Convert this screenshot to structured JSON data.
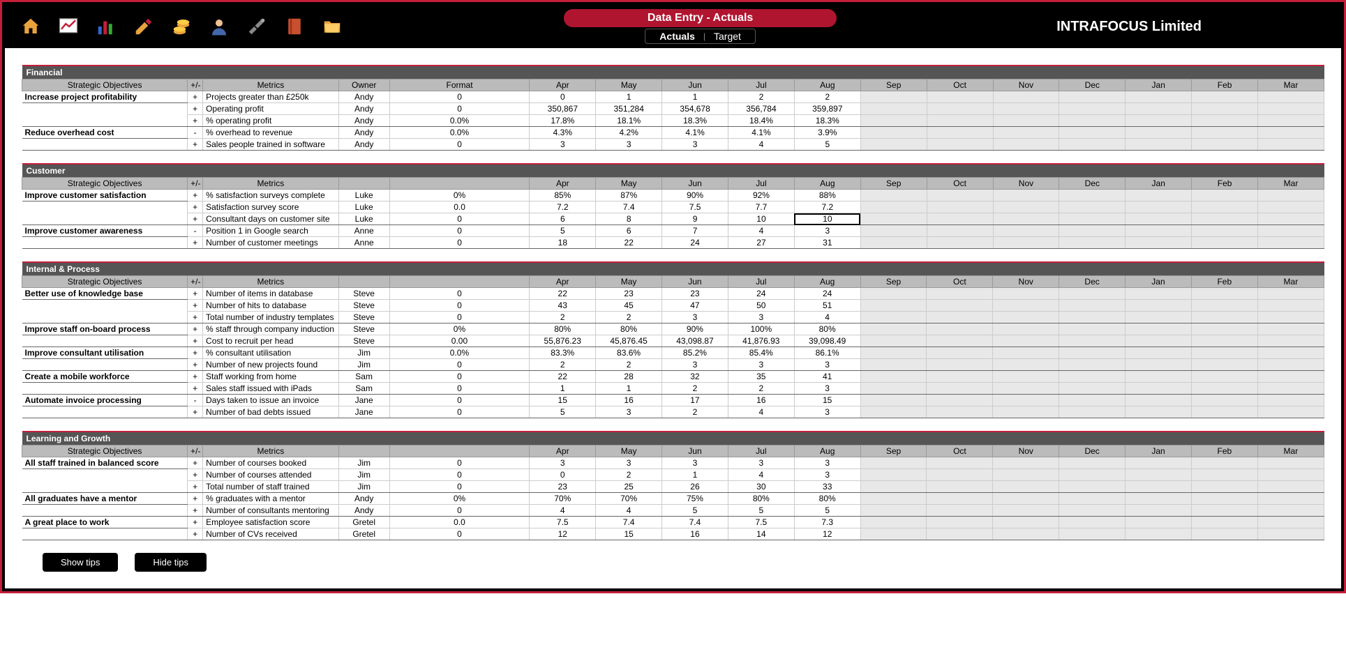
{
  "header": {
    "title": "Data Entry - Actuals",
    "tabs": {
      "actuals": "Actuals",
      "target": "Target"
    },
    "company": "INTRAFOCUS Limited"
  },
  "columns": {
    "strategic": "Strategic Objectives",
    "sign": "+/-",
    "metrics": "Metrics",
    "owner": "Owner",
    "format": "Format",
    "months": [
      "Apr",
      "May",
      "Jun",
      "Jul",
      "Aug",
      "Sep",
      "Oct",
      "Nov",
      "Dec",
      "Jan",
      "Feb",
      "Mar"
    ]
  },
  "buttons": {
    "show": "Show tips",
    "hide": "Hide tips"
  },
  "sections": [
    {
      "name": "Financial",
      "showOwner": true,
      "showFormat": true,
      "groups": [
        {
          "objective": "Increase project profitability",
          "rows": [
            {
              "sign": "+",
              "metric": "Projects greater than £250k",
              "owner": "Andy",
              "format": "0",
              "vals": [
                "0",
                "1",
                "1",
                "2",
                "2"
              ]
            },
            {
              "sign": "+",
              "metric": "Operating profit",
              "owner": "Andy",
              "format": "0",
              "vals": [
                "350,867",
                "351,284",
                "354,678",
                "356,784",
                "359,897"
              ]
            },
            {
              "sign": "+",
              "metric": "% operating profit",
              "owner": "Andy",
              "format": "0.0%",
              "vals": [
                "17.8%",
                "18.1%",
                "18.3%",
                "18.4%",
                "18.3%"
              ]
            }
          ]
        },
        {
          "objective": "Reduce overhead cost",
          "rows": [
            {
              "sign": "-",
              "metric": "% overhead to revenue",
              "owner": "Andy",
              "format": "0.0%",
              "vals": [
                "4.3%",
                "4.2%",
                "4.1%",
                "4.1%",
                "3.9%"
              ]
            },
            {
              "sign": "+",
              "metric": "Sales people trained in software",
              "owner": "Andy",
              "format": "0",
              "vals": [
                "3",
                "3",
                "3",
                "4",
                "5"
              ]
            }
          ]
        }
      ]
    },
    {
      "name": "Customer",
      "showOwner": false,
      "showFormat": false,
      "groups": [
        {
          "objective": "Improve customer satisfaction",
          "rows": [
            {
              "sign": "+",
              "metric": "% satisfaction surveys complete",
              "owner": "Luke",
              "format": "0%",
              "vals": [
                "85%",
                "87%",
                "90%",
                "92%",
                "88%"
              ]
            },
            {
              "sign": "+",
              "metric": "Satisfaction survey score",
              "owner": "Luke",
              "format": "0.0",
              "vals": [
                "7.2",
                "7.4",
                "7.5",
                "7.7",
                "7.2"
              ]
            },
            {
              "sign": "+",
              "metric": "Consultant days on customer site",
              "owner": "Luke",
              "format": "0",
              "vals": [
                "6",
                "8",
                "9",
                "10",
                "10"
              ],
              "selectedIdx": 4
            }
          ]
        },
        {
          "objective": "Improve customer awareness",
          "rows": [
            {
              "sign": "-",
              "metric": "Position 1 in Google search",
              "owner": "Anne",
              "format": "0",
              "vals": [
                "5",
                "6",
                "7",
                "4",
                "3"
              ]
            },
            {
              "sign": "+",
              "metric": "Number of customer meetings",
              "owner": "Anne",
              "format": "0",
              "vals": [
                "18",
                "22",
                "24",
                "27",
                "31"
              ]
            }
          ]
        }
      ]
    },
    {
      "name": "Internal & Process",
      "showOwner": false,
      "showFormat": false,
      "groups": [
        {
          "objective": "Better use of knowledge base",
          "rows": [
            {
              "sign": "+",
              "metric": "Number of items in database",
              "owner": "Steve",
              "format": "0",
              "vals": [
                "22",
                "23",
                "23",
                "24",
                "24"
              ]
            },
            {
              "sign": "+",
              "metric": "Number of hits to database",
              "owner": "Steve",
              "format": "0",
              "vals": [
                "43",
                "45",
                "47",
                "50",
                "51"
              ]
            },
            {
              "sign": "+",
              "metric": "Total number of industry templates",
              "owner": "Steve",
              "format": "0",
              "vals": [
                "2",
                "2",
                "3",
                "3",
                "4"
              ]
            }
          ]
        },
        {
          "objective": "Improve staff on-board process",
          "rows": [
            {
              "sign": "+",
              "metric": "% staff through company induction",
              "owner": "Steve",
              "format": "0%",
              "vals": [
                "80%",
                "80%",
                "90%",
                "100%",
                "80%"
              ]
            },
            {
              "sign": "+",
              "metric": "Cost to recruit per head",
              "owner": "Steve",
              "format": "0.00",
              "vals": [
                "55,876.23",
                "45,876.45",
                "43,098.87",
                "41,876.93",
                "39,098.49"
              ]
            }
          ]
        },
        {
          "objective": "Improve consultant utilisation",
          "rows": [
            {
              "sign": "+",
              "metric": "% consultant utilisation",
              "owner": "Jim",
              "format": "0.0%",
              "vals": [
                "83.3%",
                "83.6%",
                "85.2%",
                "85.4%",
                "86.1%"
              ]
            },
            {
              "sign": "+",
              "metric": "Number of new projects found",
              "owner": "Jim",
              "format": "0",
              "vals": [
                "2",
                "2",
                "3",
                "3",
                "3"
              ]
            }
          ]
        },
        {
          "objective": "Create a mobile workforce",
          "rows": [
            {
              "sign": "+",
              "metric": "Staff working from home",
              "owner": "Sam",
              "format": "0",
              "vals": [
                "22",
                "28",
                "32",
                "35",
                "41"
              ]
            },
            {
              "sign": "+",
              "metric": "Sales staff issued with iPads",
              "owner": "Sam",
              "format": "0",
              "vals": [
                "1",
                "1",
                "2",
                "2",
                "3"
              ]
            }
          ]
        },
        {
          "objective": "Automate invoice processing",
          "rows": [
            {
              "sign": "-",
              "metric": "Days taken to issue an invoice",
              "owner": "Jane",
              "format": "0",
              "vals": [
                "15",
                "16",
                "17",
                "16",
                "15"
              ]
            },
            {
              "sign": "+",
              "metric": "Number of bad debts issued",
              "owner": "Jane",
              "format": "0",
              "vals": [
                "5",
                "3",
                "2",
                "4",
                "3"
              ]
            }
          ]
        }
      ]
    },
    {
      "name": "Learning and Growth",
      "showOwner": false,
      "showFormat": false,
      "groups": [
        {
          "objective": "All staff trained in balanced score",
          "rows": [
            {
              "sign": "+",
              "metric": "Number of courses booked",
              "owner": "Jim",
              "format": "0",
              "vals": [
                "3",
                "3",
                "3",
                "3",
                "3"
              ]
            },
            {
              "sign": "+",
              "metric": "Number of courses attended",
              "owner": "Jim",
              "format": "0",
              "vals": [
                "0",
                "2",
                "1",
                "4",
                "3"
              ]
            },
            {
              "sign": "+",
              "metric": "Total number of staff trained",
              "owner": "Jim",
              "format": "0",
              "vals": [
                "23",
                "25",
                "26",
                "30",
                "33"
              ]
            }
          ]
        },
        {
          "objective": "All graduates have a mentor",
          "rows": [
            {
              "sign": "+",
              "metric": "% graduates with a mentor",
              "owner": "Andy",
              "format": "0%",
              "vals": [
                "70%",
                "70%",
                "75%",
                "80%",
                "80%"
              ]
            },
            {
              "sign": "+",
              "metric": "Number of consultants mentoring",
              "owner": "Andy",
              "format": "0",
              "vals": [
                "4",
                "4",
                "5",
                "5",
                "5"
              ]
            }
          ]
        },
        {
          "objective": "A great place to work",
          "rows": [
            {
              "sign": "+",
              "metric": "Employee satisfaction score",
              "owner": "Gretel",
              "format": "0.0",
              "vals": [
                "7.5",
                "7.4",
                "7.4",
                "7.5",
                "7.3"
              ]
            },
            {
              "sign": "+",
              "metric": "Number of CVs received",
              "owner": "Gretel",
              "format": "0",
              "vals": [
                "12",
                "15",
                "16",
                "14",
                "12"
              ]
            }
          ]
        }
      ]
    }
  ]
}
